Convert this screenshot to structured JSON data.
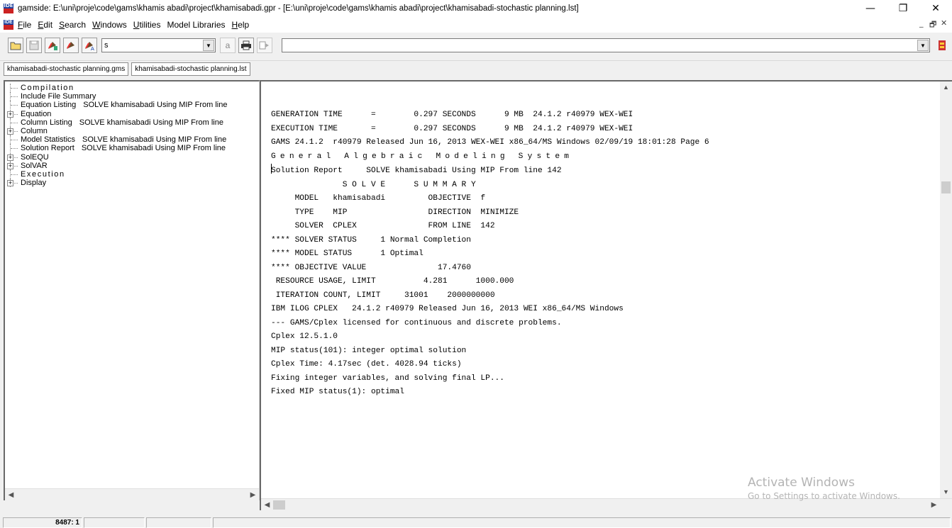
{
  "window": {
    "title": "gamside: E:\\uni\\proje\\code\\gams\\khamis abadi\\project\\khamisabadi.gpr - [E:\\uni\\proje\\code\\gams\\khamis abadi\\project\\khamisabadi-stochastic planning.lst]",
    "app_icon_text": "IDE",
    "minimize": "—",
    "maximize": "❐",
    "close": "✕"
  },
  "menubar": {
    "items": [
      {
        "accel": "F",
        "rest": "ile"
      },
      {
        "accel": "E",
        "rest": "dit"
      },
      {
        "accel": "S",
        "rest": "earch"
      },
      {
        "accel": "W",
        "rest": "indows"
      },
      {
        "accel": "U",
        "rest": "tilities"
      },
      {
        "accel": "",
        "rest": "Model Libraries"
      },
      {
        "accel": "H",
        "rest": "elp"
      }
    ],
    "mdi_minimize": "_",
    "mdi_restore": "🗗",
    "mdi_close": "✕"
  },
  "toolbar": {
    "search_value": "s",
    "param_value": "",
    "a_button": "a"
  },
  "tabs": [
    "khamisabadi-stochastic planning.gms",
    "khamisabadi-stochastic planning.lst"
  ],
  "tree": [
    {
      "label": "Compilation",
      "desc": "",
      "expand": false,
      "spaced": true
    },
    {
      "label": "Include File Summary",
      "desc": "",
      "expand": false,
      "spaced": false
    },
    {
      "label": "Equation Listing",
      "desc": "SOLVE khamisabadi Using MIP From line",
      "expand": false,
      "spaced": false
    },
    {
      "label": "Equation",
      "desc": "",
      "expand": true,
      "spaced": false
    },
    {
      "label": "Column Listing",
      "desc": "SOLVE khamisabadi Using MIP From line",
      "expand": false,
      "spaced": false
    },
    {
      "label": "Column",
      "desc": "",
      "expand": true,
      "spaced": false
    },
    {
      "label": "Model Statistics",
      "desc": "SOLVE khamisabadi Using MIP From line",
      "expand": false,
      "spaced": false
    },
    {
      "label": "Solution Report",
      "desc": "SOLVE khamisabadi Using MIP From line",
      "expand": false,
      "spaced": false
    },
    {
      "label": "SolEQU",
      "desc": "",
      "expand": true,
      "spaced": false
    },
    {
      "label": "SolVAR",
      "desc": "",
      "expand": true,
      "spaced": false
    },
    {
      "label": "Execution",
      "desc": "",
      "expand": false,
      "spaced": true
    },
    {
      "label": "Display",
      "desc": "",
      "expand": true,
      "spaced": false
    }
  ],
  "listing": [
    "",
    "GENERATION TIME      =        0.297 SECONDS      9 MB  24.1.2 r40979 WEX-WEI",
    "",
    "",
    "EXECUTION TIME       =        0.297 SECONDS      9 MB  24.1.2 r40979 WEX-WEI",
    "GAMS 24.1.2  r40979 Released Jun 16, 2013 WEX-WEI x86_64/MS Windows 02/09/19 18:01:28 Page 6",
    "General Algebraic Modeling System",
    "Solution Report     SOLVE khamisabadi Using MIP From line 142",
    "",
    "",
    "               S O L V E      S U M M A R Y",
    "",
    "     MODEL   khamisabadi         OBJECTIVE  f",
    "     TYPE    MIP                 DIRECTION  MINIMIZE",
    "     SOLVER  CPLEX               FROM LINE  142",
    "",
    "**** SOLVER STATUS     1 Normal Completion",
    "**** MODEL STATUS      1 Optimal",
    "**** OBJECTIVE VALUE               17.4760",
    "",
    " RESOURCE USAGE, LIMIT          4.281      1000.000",
    " ITERATION COUNT, LIMIT     31001    2000000000",
    "",
    "IBM ILOG CPLEX   24.1.2 r40979 Released Jun 16, 2013 WEI x86_64/MS Windows",
    "--- GAMS/Cplex licensed for continuous and discrete problems.",
    "Cplex 12.5.1.0",
    "",
    "MIP status(101): integer optimal solution",
    "Cplex Time: 4.17sec (det. 4028.94 ticks)",
    "Fixing integer variables, and solving final LP...",
    "Fixed MIP status(1): optimal"
  ],
  "watermark": {
    "line1": "Activate Windows",
    "line2": "Go to Settings to activate Windows."
  },
  "status": {
    "position": "8487: 1",
    "cell2": "",
    "cell3": "",
    "cell4": ""
  }
}
